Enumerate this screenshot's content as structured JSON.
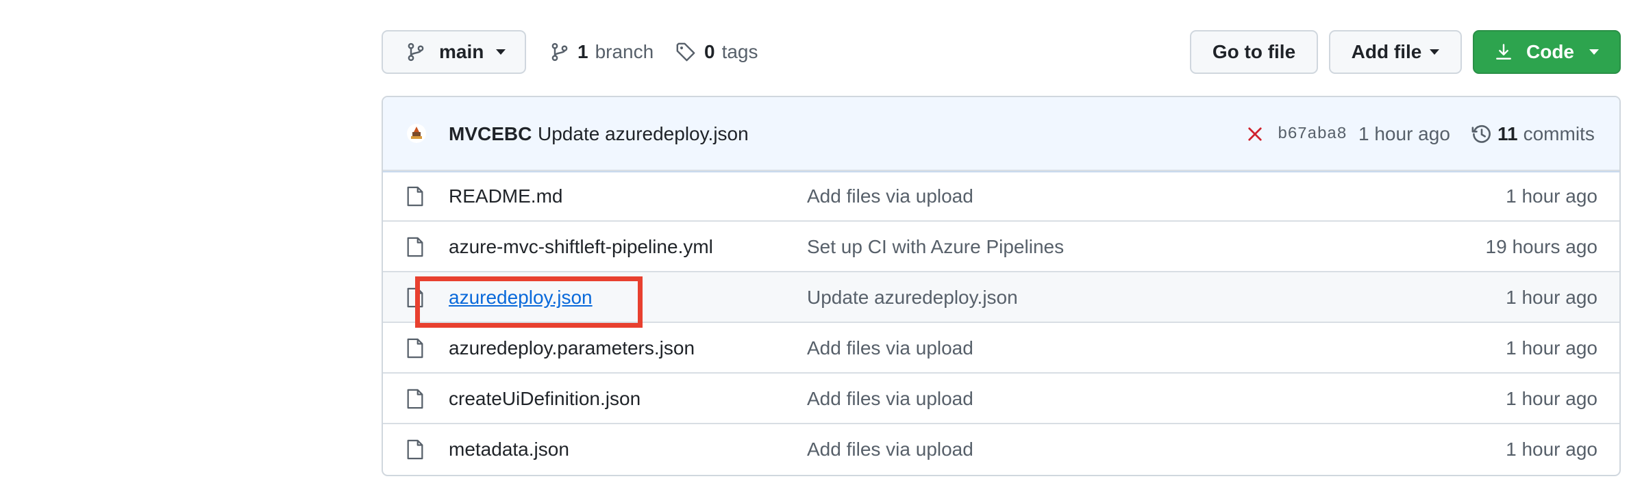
{
  "toolbar": {
    "branch_selector": "main",
    "branch_count": "1",
    "branch_label": "branch",
    "tag_count": "0",
    "tag_label": "tags",
    "go_to_file": "Go to file",
    "add_file": "Add file",
    "code": "Code"
  },
  "commit": {
    "author": "MVCEBC",
    "message": "Update azuredeploy.json",
    "status": "failed",
    "sha": "b67aba8",
    "time": "1 hour ago",
    "commit_count": "11",
    "commit_label": "commits"
  },
  "files": [
    {
      "name": "README.md",
      "message": "Add files via upload",
      "age": "1 hour ago"
    },
    {
      "name": "azure-mvc-shiftleft-pipeline.yml",
      "message": "Set up CI with Azure Pipelines",
      "age": "19 hours ago"
    },
    {
      "name": "azuredeploy.json",
      "message": "Update azuredeploy.json",
      "age": "1 hour ago"
    },
    {
      "name": "azuredeploy.parameters.json",
      "message": "Add files via upload",
      "age": "1 hour ago"
    },
    {
      "name": "createUiDefinition.json",
      "message": "Add files via upload",
      "age": "1 hour ago"
    },
    {
      "name": "metadata.json",
      "message": "Add files via upload",
      "age": "1 hour ago"
    }
  ],
  "colors": {
    "code_button": "#2da44e",
    "link": "#0969da",
    "highlight_box": "#e8402f",
    "commit_bar": "#f1f7ff",
    "fail_x": "#cf222e"
  },
  "icons": [
    "git-branch-icon",
    "tag-icon",
    "download-icon",
    "history-icon",
    "file-icon",
    "x-icon"
  ]
}
